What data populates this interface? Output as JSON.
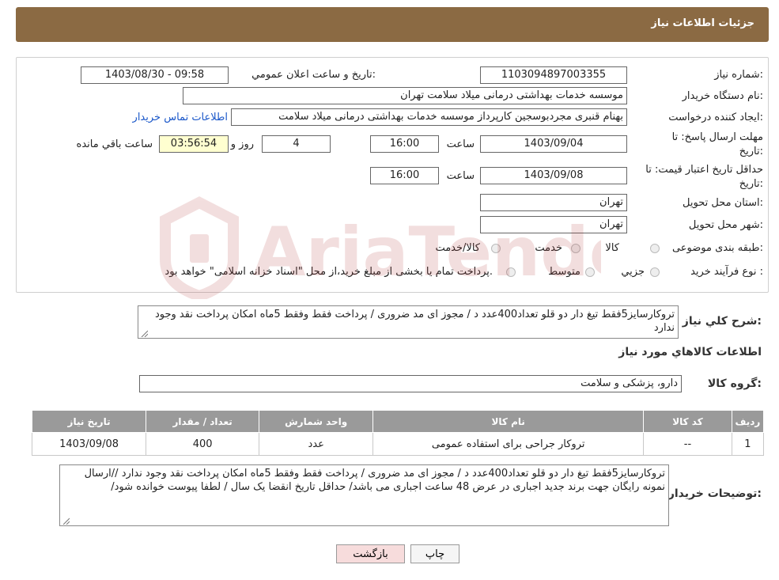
{
  "header": {
    "title": "جزئیات اطلاعات نیاز"
  },
  "form": {
    "need_number_label": "شماره نیاز:",
    "need_number": "1103094897003355",
    "announce_label": "تاریخ و ساعت اعلان عمومي:",
    "announce_value": "1403/08/30 - 09:58",
    "buyer_org_label": "نام دستگاه خریدار:",
    "buyer_org": "موسسه خدمات بهداشتی درمانی میلاد سلامت تهران",
    "creator_label": "ایجاد کننده درخواست:",
    "creator": "بهنام قنبری مجردبوسجین کارپرداز موسسه خدمات بهداشتی درمانی میلاد سلامت",
    "contact_link": "اطلاعات تماس خریدار",
    "deadline_label_1": "مهلت ارسال پاسخ: تا",
    "deadline_label_2": "تاریخ:",
    "deadline_date": "1403/09/04",
    "time_word": "ساعت",
    "deadline_time": "16:00",
    "days_value": "4",
    "days_word": "روز و",
    "remaining_time": "03:56:54",
    "remaining_word": "ساعت باقي مانده",
    "validity_label_1": "حداقل تاریخ اعتبار قیمت: تا",
    "validity_label_2": "تاریخ:",
    "validity_date": "1403/09/08",
    "validity_time": "16:00",
    "province_label": "استان محل تحویل:",
    "province": "تهران",
    "city_label": "شهر محل تحویل:",
    "city": "تهران",
    "category_label": "طبقه بندی موضوعی:",
    "category_options": [
      "کالا",
      "خدمت",
      "کالا/خدمت"
    ],
    "process_label": "نوع فرآیند خرید :",
    "process_options": [
      "جزیي",
      "متوسط"
    ],
    "process_note": "پرداخت تمام یا بخشی از مبلغ خرید،از محل \"اسناد خزانه اسلامی\" خواهد بود."
  },
  "summary": {
    "label": "شرح کلي نياز:",
    "text": "تروکارسایز5فقط  تیغ دار دو قلو تعداد400عدد د / مجوز ای مد ضروری / پرداخت فقط وفقط 5ماه امکان پرداخت نقد وجود ندارد"
  },
  "goods": {
    "section_title": "اطلاعات کالاهاي مورد نياز",
    "group_label": "گروه کالا:",
    "group_value": "دارو، پزشکی و سلامت"
  },
  "table": {
    "headers": [
      "رديف",
      "کد کالا",
      "نام کالا",
      "واحد شمارش",
      "تعداد / مقدار",
      "تاریخ نیاز"
    ],
    "rows": [
      [
        "1",
        "--",
        "تروکار جراحی برای استفاده عمومی",
        "عدد",
        "400",
        "1403/09/08"
      ]
    ]
  },
  "buyer_notes": {
    "label": "توضیحات خریدار:",
    "text": "تروکارسایز5فقط  تیغ دار دو قلو تعداد400عدد د / مجوز ای مد ضروری / پرداخت فقط وفقط 5ماه امکان پرداخت نقد وجود ندارد //ارسال نمونه رایگان جهت برند جدید اجباری در عرض 48 ساعت اجباری  می باشد/ حداقل تاریخ  انقضا یک سال / لطفا پیوست خوانده شود/"
  },
  "buttons": {
    "print": "چاپ",
    "back": "بازگشت"
  },
  "watermark": "AriaTender.neT",
  "colors": {
    "header": "#8b6a43",
    "link": "#1a57c9",
    "table_header": "#9a9a9a",
    "back_button": "#f7dcdc"
  }
}
